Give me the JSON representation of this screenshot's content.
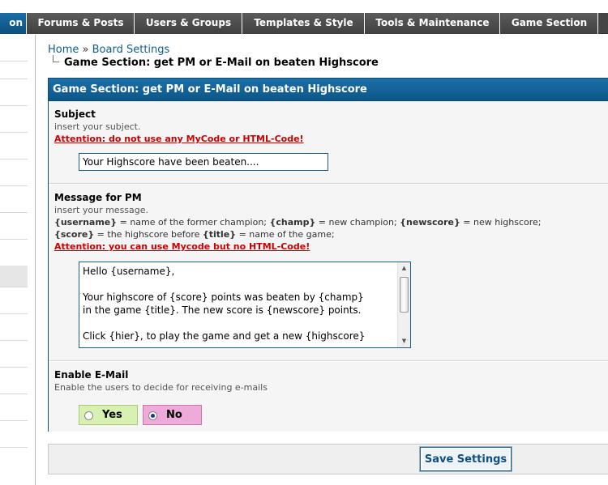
{
  "nav": {
    "tabs": [
      {
        "label": "on",
        "active": true
      },
      {
        "label": "Forums & Posts",
        "active": false
      },
      {
        "label": "Users & Groups",
        "active": false
      },
      {
        "label": "Templates & Style",
        "active": false
      },
      {
        "label": "Tools & Maintenance",
        "active": false
      },
      {
        "label": "Game Section",
        "active": false
      }
    ]
  },
  "breadcrumb": {
    "home": "Home",
    "separator": "»",
    "board_settings": "Board Settings",
    "current": "Game Section: get PM or E-Mail on beaten Highscore"
  },
  "form": {
    "header": "Game Section: get PM or E-Mail on beaten Highscore",
    "subject": {
      "title": "Subject",
      "description": "insert your subject.",
      "warning": "Attention: do not use any MyCode or HTML-Code!",
      "value": "Your Highscore have been beaten...."
    },
    "message": {
      "title": "Message for PM",
      "description": "insert your message.",
      "vars_line1": {
        "v1": "{username}",
        "t1": " = name of the former champion; ",
        "v2": "{champ}",
        "t2": " = new champion; ",
        "v3": "{newscore}",
        "t3": " = new highscore;"
      },
      "vars_line2": {
        "v1": "{score}",
        "t1": " = the highscore before ",
        "v2": "{title}",
        "t2": " = name of the game;"
      },
      "warning": "Attention: you can use Mycode but no HTML-Code!",
      "lines": [
        "Hello {username},",
        "",
        "Your highscore of {score} points was beaten by {champ}",
        "in the game {title}. The new score is {newscore} points.",
        "",
        "Click {hier}, to play the game and get a new {highscore}"
      ]
    },
    "email": {
      "title": "Enable E-Mail",
      "description": "Enable the users to decide for receiving e-mails",
      "yes_label": "Yes",
      "no_label": "No",
      "selected": "No"
    }
  },
  "save_button": "Save Settings",
  "colors": {
    "header_blue": "#0d5688",
    "warning_red": "#cc0000",
    "yes_bg": "#d8f0b0",
    "no_bg": "#eeaad8"
  }
}
